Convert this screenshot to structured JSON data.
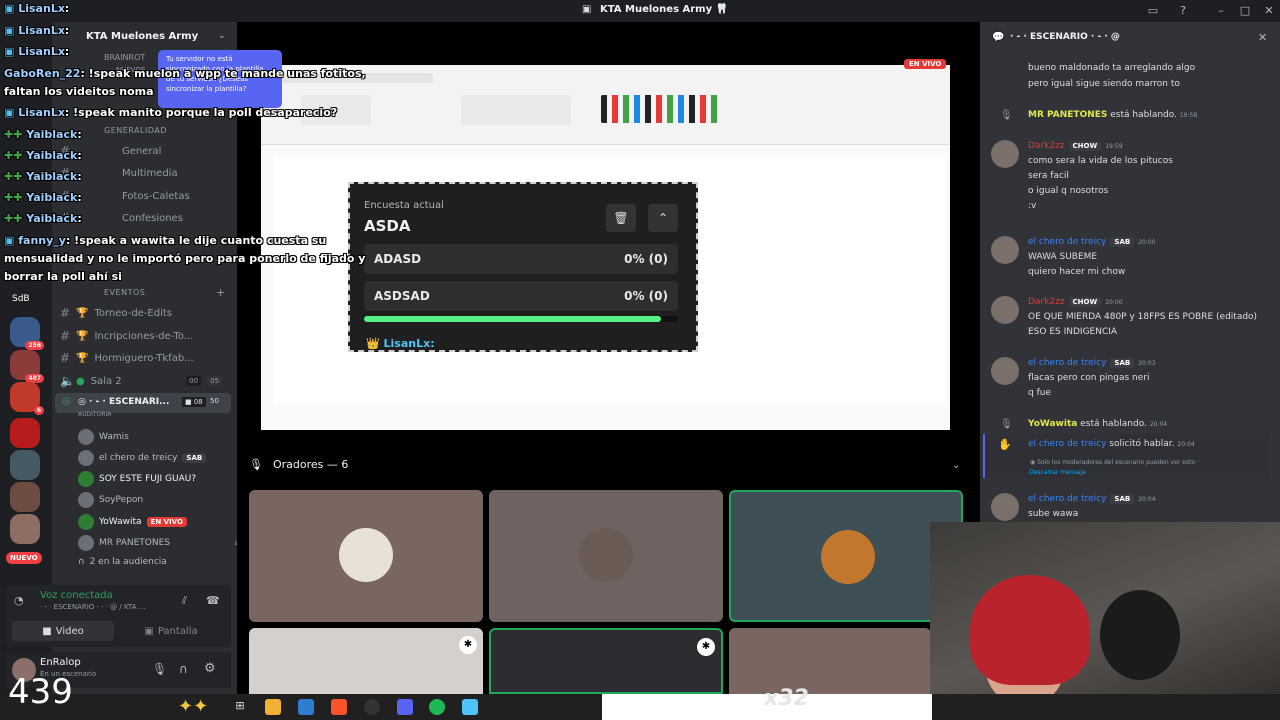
{
  "window": {
    "title": "KTA Muelones Army 🦷"
  },
  "server": {
    "name": "KTA Muelones Army",
    "brainrot": "BRAINROT",
    "nuevos": "NUEVOS"
  },
  "server_rail": {
    "badges": [
      "256",
      "487",
      "6"
    ],
    "label_sdb": "SdB",
    "new_badge": "NUEVO"
  },
  "tooltip": {
    "text": "Tu servidor no está sincronizado con la plantilla de tu servidor. ¿Deseas sincronizar la plantilla?"
  },
  "categories": {
    "general": "GENERALIDAD",
    "eventos": "EVENTOS"
  },
  "channels": [
    {
      "name": "General"
    },
    {
      "name": "Multimedia"
    },
    {
      "name": "Fotos-Caletas"
    },
    {
      "name": "Confesiones"
    }
  ],
  "event_channels": [
    {
      "name": "Torneo-de-Edits"
    },
    {
      "name": "Incripciones-de-To..."
    },
    {
      "name": "Hormiguero-Tkfab..."
    }
  ],
  "voice_channel": {
    "name": "Sala 2",
    "count_a": "00",
    "count_b": "05"
  },
  "stage_channel": {
    "name": "ESCENARI...",
    "sub": "AUDITORIA",
    "cam": "08",
    "num": "50"
  },
  "stage_members": [
    {
      "name": "Wamis"
    },
    {
      "name": "el chero de treicy",
      "tag": "SAB"
    },
    {
      "name": "SOY ESTE FUJI GUAU?"
    },
    {
      "name": "SoyPepon"
    },
    {
      "name": "YoWawita",
      "live": "EN VIVO"
    },
    {
      "name": "MR PANETONES"
    },
    {
      "name": "2 en la audiencia"
    }
  ],
  "voice_status": {
    "connected": "Voz conectada",
    "channel": "· - · ESCENARIO · - · @ / KTA ...",
    "video": "Video",
    "screen": "Pantalla"
  },
  "user": {
    "name": "EnRalop",
    "status": "En un escenario"
  },
  "stream": {
    "live": "EN VIVO"
  },
  "poll": {
    "label": "Encuesta actual",
    "title": "ASDA",
    "options": [
      {
        "text": "ADASD",
        "value": "0% (0)"
      },
      {
        "text": "ASDSAD",
        "value": "0% (0)"
      }
    ],
    "footer_user": "LisanLx:"
  },
  "speakers": {
    "header": "Oradores — 6"
  },
  "chat": {
    "header": "· - · ESCENARIO · - · @",
    "messages": [
      {
        "lines": [
          "bueno maldonado ta arreglando algo",
          "pero igual sigue siendo marron to"
        ]
      },
      {
        "system": "MR PANETONES",
        "system_text": "está hablando.",
        "time": "19:58"
      },
      {
        "author": "Dark2zz",
        "tag": "CHOW",
        "time": "19:59",
        "color": "#e53935",
        "lines": [
          "como sera la vida de los pitucos",
          "sera facil",
          "o igual q nosotros",
          ":v"
        ]
      },
      {
        "author": "el chero de treicy",
        "tag": "SAB",
        "time": "20:00",
        "color": "#3b82f6",
        "lines": [
          "WAWA SUBEME",
          "quiero hacer mi chow"
        ]
      },
      {
        "author": "Dark2zz",
        "tag": "CHOW",
        "time": "20:00",
        "color": "#e53935",
        "lines": [
          "OE QUE MIERDA 480P y 18FPS ES POBRE (editado)",
          "ESO ES INDIGENCIA"
        ]
      },
      {
        "author": "el chero de treicy",
        "tag": "SAB",
        "time": "20:03",
        "color": "#3b82f6",
        "lines": [
          "flacas pero con pingas neri",
          "q fue"
        ]
      },
      {
        "system": "YoWawita",
        "system_text": "está hablando.",
        "time": "20:04"
      },
      {
        "system": "el chero de treicy",
        "system_text": "solicitó hablar.",
        "time": "20:04",
        "note": "Solo los moderadores del escenario pueden ver esto ·",
        "note_link": "Descartar mensaje"
      },
      {
        "author": "el chero de treicy",
        "tag": "SAB",
        "time": "20:04",
        "color": "#3b82f6",
        "lines": [
          "sube wawa"
        ]
      }
    ]
  },
  "overlay_chat": [
    {
      "user": "LisanLx",
      "text": ":"
    },
    {
      "user": "LisanLx",
      "text": ":"
    },
    {
      "user": "LisanLx",
      "text": ":"
    },
    {
      "user": "GaboRen_22",
      "text": ": !speak muelon a wpp te mande unas fotitos,"
    },
    {
      "user": "",
      "text": "faltan los videitos noma"
    },
    {
      "user": "LisanLx",
      "text": ": !speak manito porque la poll desaparecio?"
    },
    {
      "user": "Yaiblack",
      "text": ":"
    },
    {
      "user": "Yaiblack",
      "text": ":"
    },
    {
      "user": "Yaiblack",
      "text": ":"
    },
    {
      "user": "Yaiblack",
      "text": ":"
    },
    {
      "user": "Yaiblack",
      "text": ":"
    },
    {
      "user": "fanny_y",
      "text": ": !speak a wawita le dije cuanto cuesta su"
    },
    {
      "user": "",
      "text": "mensualidad y no le importó pero para ponerlo de fijado y"
    },
    {
      "user": "",
      "text": "borrar la poll ahí si"
    }
  ],
  "overlay": {
    "count": "439",
    "multiplier": "x32"
  },
  "colors": {
    "accent": "#5865f2",
    "live": "#e53935",
    "green": "#57f287"
  }
}
